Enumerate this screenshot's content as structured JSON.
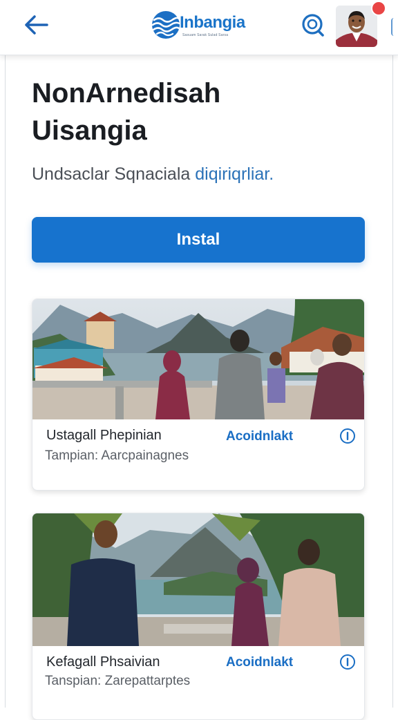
{
  "header": {
    "back_icon": "arrow-left-icon",
    "logo_name": "Inbangia",
    "logo_tagline": "Sasuam Sarak Sulad Sarsa",
    "search_icon": "search-icon",
    "avatar": "user-avatar",
    "notification_color": "#e94545"
  },
  "hero": {
    "title_line1": "NonArnedisah",
    "title_line2": "Uisangia",
    "subtitle_main": "Undsaclar Sqnaciala ",
    "subtitle_accent": "diqiriqrliar."
  },
  "install": {
    "label": "Instal",
    "color": "#1773ce"
  },
  "cards": [
    {
      "title": "Ustagall Phepinian",
      "subtitle": "Tampian: Aarcpainagnes",
      "link": "Acoidnlakt",
      "info_icon": "info-icon"
    },
    {
      "title": "Kefagall Phsaivian",
      "subtitle": "Tanspian: Zarepattarptes",
      "link": "Acoidnlakt",
      "info_icon": "info-icon"
    }
  ],
  "colors": {
    "accent": "#1773ce",
    "link": "#1a6ec4",
    "title": "#1a1d22"
  }
}
